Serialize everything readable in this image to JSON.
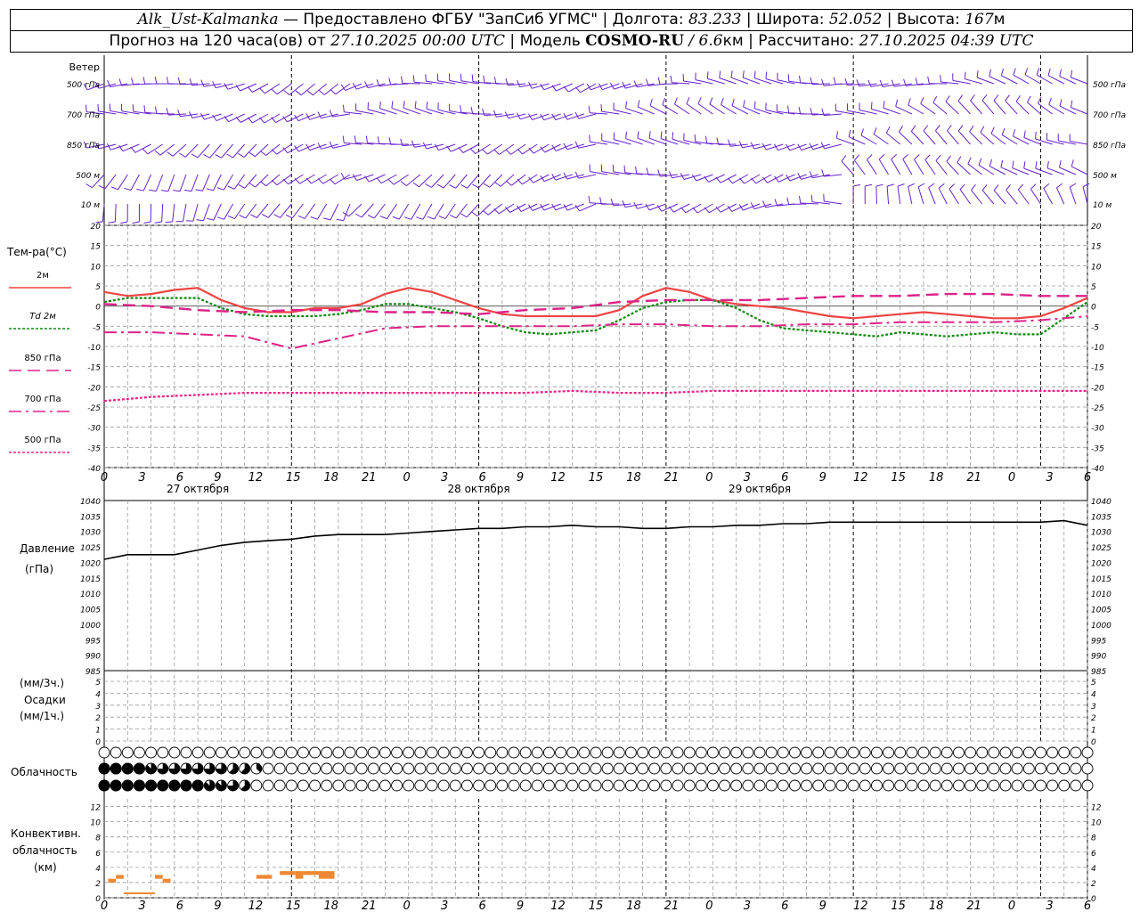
{
  "header": {
    "station": "Alk_Ust-Kalmanka",
    "sep1": " — ",
    "provider": "Предоставлено ФГБУ \"ЗапСиб УГМС\"",
    "sep2": " | ",
    "lon_label": "Долгота: ",
    "lon_value": "83.233",
    "sep3": " | ",
    "lat_label": "Широта: ",
    "lat_value": "52.052",
    "sep4": " | ",
    "alt_label": "Высота: ",
    "alt_value": "167",
    "alt_unit": "м"
  },
  "subheader": {
    "forecast_label": "Прогноз на 120 часа(ов) от ",
    "init_time": "27.10.2025 00:00 UTC",
    "model_label": "  | Модель ",
    "model_name": "COSMO-RU",
    "model_res": " / 6.6",
    "model_res_unit": "км",
    "calc_label": " | Рассчитано: ",
    "calc_time": "27.10.2025 04:39 UTC"
  },
  "wind_panel": {
    "title": "Ветер",
    "levels": [
      "500 гПа",
      "700 гПа",
      "850 гПа",
      "500 м",
      "10 м"
    ],
    "right_levels": [
      "500 гПа",
      "700 гПа",
      "850 гПа",
      "500 м",
      "10 м"
    ]
  },
  "temp_panel": {
    "title": "Тем-ра(°C)",
    "legend": [
      "2м",
      "Td  2м",
      "850 гПа",
      "700 гПа",
      "500 гПа"
    ],
    "yticks": [
      "20",
      "15",
      "10",
      "5",
      "0",
      "-5",
      "-10",
      "-15",
      "-20",
      "-25",
      "-30",
      "-35",
      "-40"
    ]
  },
  "time_axis": {
    "hour_labels": [
      "0",
      "3",
      "6",
      "9",
      "12",
      "15",
      "18",
      "21",
      "0",
      "3",
      "6",
      "9",
      "12",
      "15",
      "18",
      "21",
      "0",
      "3",
      "6",
      "9",
      "12",
      "15",
      "18",
      "21",
      "0",
      "3",
      "6"
    ],
    "date_labels": [
      "27 октября",
      "28 октября",
      "29 октября"
    ]
  },
  "pressure_panel": {
    "title": "Давление",
    "unit": "(гПа)",
    "yticks": [
      "1040",
      "1035",
      "1030",
      "1025",
      "1020",
      "1015",
      "1010",
      "1005",
      "1000",
      "995",
      "990",
      "985"
    ]
  },
  "precip_panel": {
    "line1": "(мм/3ч.)",
    "line2": "Осадки",
    "line3": "(мм/1ч.)",
    "yticks": [
      "5",
      "4",
      "3",
      "2",
      "1",
      "0"
    ]
  },
  "cloud_panel": {
    "title": "Облачность"
  },
  "conv_panel": {
    "line1": "Конвективн.",
    "line2": "облачность",
    "line3": "(км)",
    "yticks": [
      "12",
      "10",
      "8",
      "6",
      "4",
      "2",
      "0"
    ]
  },
  "colors": {
    "t2m": "#ee4444",
    "td2m": "#118811",
    "t850": "#dd2288",
    "t700": "#dd2288",
    "t500": "#ee2288",
    "wind": "#6622cc",
    "pressure": "#000000",
    "conv": "#ee8833",
    "grid": "#999999"
  },
  "chart_data": [
    {
      "type": "line",
      "name": "temperature",
      "x_unit": "hours since 27.10.2025 00:00 UTC",
      "ylim": [
        -40,
        20
      ],
      "series": [
        {
          "name": "2м",
          "x": [
            0,
            3,
            6,
            9,
            12,
            15,
            18,
            21,
            24,
            27,
            30,
            33,
            36,
            39,
            42,
            45,
            48,
            51,
            54,
            57,
            60,
            63,
            66,
            69,
            72,
            75,
            78,
            81,
            84,
            87,
            90,
            93,
            96,
            99,
            102,
            105,
            108,
            111,
            114,
            117,
            120,
            123,
            126
          ],
          "values": [
            3.5,
            2.5,
            3,
            4,
            4.5,
            1.5,
            -0.5,
            -1.5,
            -1.5,
            -0.5,
            -0.5,
            0.5,
            3,
            4.5,
            3.5,
            1.5,
            -0.5,
            -2,
            -2.5,
            -2.5,
            -2.5,
            -2.5,
            -1,
            2.5,
            4.5,
            3.5,
            1.5,
            0.5,
            0,
            -0.5,
            -1.5,
            -2.5,
            -3,
            -2.5,
            -2,
            -1.5,
            -2,
            -2.5,
            -3,
            -3,
            -2.5,
            -0.5,
            2
          ]
        },
        {
          "name": "Td  2м",
          "x": [
            0,
            3,
            6,
            9,
            12,
            15,
            18,
            21,
            24,
            27,
            30,
            33,
            36,
            39,
            42,
            45,
            48,
            51,
            54,
            57,
            60,
            63,
            66,
            69,
            72,
            75,
            78,
            81,
            84,
            87,
            90,
            93,
            96,
            99,
            102,
            105,
            108,
            111,
            114,
            117,
            120,
            123,
            126
          ],
          "values": [
            1,
            2,
            2,
            2,
            2,
            -0.5,
            -2,
            -2.5,
            -2.5,
            -2.5,
            -2,
            -1,
            0.5,
            0.5,
            -0.5,
            -1.5,
            -3,
            -5,
            -6.5,
            -7,
            -6.5,
            -6,
            -3.5,
            -0.5,
            1,
            1.5,
            1.5,
            -0.5,
            -3.5,
            -5.5,
            -6,
            -6.5,
            -7,
            -7.5,
            -6.5,
            -7,
            -7.5,
            -7,
            -6.5,
            -7,
            -7,
            -3,
            1
          ]
        },
        {
          "name": "850 гПа",
          "x": [
            0,
            6,
            12,
            18,
            24,
            30,
            36,
            42,
            48,
            54,
            60,
            66,
            72,
            78,
            84,
            90,
            96,
            102,
            108,
            114,
            120,
            126
          ],
          "values": [
            0.5,
            0,
            -1,
            -1.5,
            -1,
            -1,
            -1.5,
            -1.5,
            -2,
            -1,
            -0.5,
            1,
            1.5,
            1.5,
            1.5,
            2,
            2.5,
            2.5,
            3,
            3,
            2.5,
            2.5
          ]
        },
        {
          "name": "700 гПа",
          "x": [
            0,
            6,
            12,
            18,
            24,
            30,
            36,
            42,
            48,
            54,
            60,
            66,
            72,
            78,
            84,
            90,
            96,
            102,
            108,
            114,
            120,
            126
          ],
          "values": [
            -6.5,
            -6.5,
            -7,
            -7.5,
            -10.5,
            -8,
            -5.5,
            -5,
            -5,
            -5,
            -5,
            -4.5,
            -4.5,
            -5,
            -5,
            -4.5,
            -4.5,
            -4,
            -4,
            -4,
            -3.5,
            -2.5
          ]
        },
        {
          "name": "500 гПа",
          "x": [
            0,
            6,
            12,
            18,
            24,
            30,
            36,
            42,
            48,
            54,
            60,
            66,
            72,
            78,
            84,
            90,
            96,
            102,
            108,
            114,
            120,
            126
          ],
          "values": [
            -23.5,
            -22.5,
            -22,
            -21.5,
            -21.5,
            -21.5,
            -21.5,
            -21.5,
            -21.5,
            -21.5,
            -21,
            -21.5,
            -21.5,
            -21,
            -21,
            -21,
            -21,
            -21,
            -21,
            -21,
            -21,
            -21
          ]
        }
      ]
    },
    {
      "type": "line",
      "name": "pressure",
      "x_unit": "hours since 27.10.2025 00:00 UTC",
      "ylim": [
        985,
        1040
      ],
      "x": [
        0,
        3,
        6,
        9,
        12,
        15,
        18,
        21,
        24,
        27,
        30,
        33,
        36,
        39,
        42,
        45,
        48,
        51,
        54,
        57,
        60,
        63,
        66,
        69,
        72,
        75,
        78,
        81,
        84,
        87,
        90,
        93,
        96,
        99,
        102,
        105,
        108,
        111,
        114,
        117,
        120,
        123,
        126
      ],
      "values": [
        1021,
        1022.5,
        1022.5,
        1022.5,
        1024,
        1025.5,
        1026.5,
        1027,
        1027.5,
        1028.5,
        1029,
        1029,
        1029,
        1029.5,
        1030,
        1030.5,
        1031,
        1031,
        1031.5,
        1031.5,
        1032,
        1031.5,
        1031.5,
        1031,
        1031,
        1031.5,
        1031.5,
        1032,
        1032,
        1032.5,
        1032.5,
        1033,
        1033,
        1033,
        1033,
        1033,
        1033,
        1033,
        1033,
        1033,
        1033,
        1033.5,
        1032
      ]
    },
    {
      "type": "bar",
      "name": "convective_cloud",
      "x_unit": "hours since 27.10.2025 00:00 UTC",
      "ylim": [
        0,
        13
      ],
      "segments": [
        {
          "x0": 0.5,
          "x1": 1.5,
          "base": 2,
          "top": 2.5
        },
        {
          "x0": 1.5,
          "x1": 2.5,
          "base": 2.5,
          "top": 3
        },
        {
          "x0": 2.5,
          "x1": 6.5,
          "base": 0.5,
          "top": 0.7
        },
        {
          "x0": 6.5,
          "x1": 7.5,
          "base": 2.5,
          "top": 3
        },
        {
          "x0": 7.5,
          "x1": 8.5,
          "base": 2,
          "top": 2.5
        },
        {
          "x0": 19.5,
          "x1": 21.5,
          "base": 2.5,
          "top": 3
        },
        {
          "x0": 22.5,
          "x1": 24.5,
          "base": 3,
          "top": 3.5
        },
        {
          "x0": 24.5,
          "x1": 25.5,
          "base": 2.5,
          "top": 3.5
        },
        {
          "x0": 25.5,
          "x1": 27.5,
          "base": 3,
          "top": 3.5
        },
        {
          "x0": 27.5,
          "x1": 29.5,
          "base": 2.5,
          "top": 3.5
        }
      ]
    },
    {
      "type": "heatmap",
      "name": "cloud_cover",
      "x_unit": "hours since 27.10.2025 00:00 UTC",
      "x_step": 1,
      "rows": [
        "upper",
        "middle",
        "lower"
      ],
      "upper": "0000000000000000000000000000000000000000000000000000000000000000000000000000000000000000000000000000000000000000000000000000000",
      "middle": "8888766666655300000000000000000000000000000000000000000000000000000000000000000000000000000000000000000000000000000000000000000",
      "lower": "8888888887765000000000000000000000000000000000000000000000000000000000000000000000000000000000000000000000000000000000000000000"
    }
  ]
}
